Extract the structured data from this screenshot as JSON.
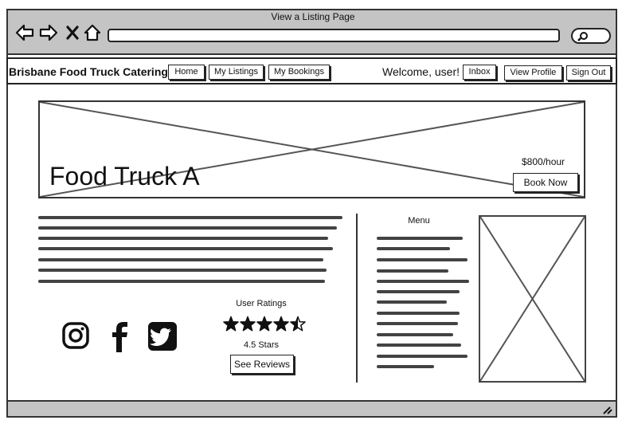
{
  "browser": {
    "title": "View a Listing Page",
    "url": "",
    "search": ""
  },
  "nav": {
    "brand": "Brisbane Food Truck Catering",
    "home": "Home",
    "my_listings": "My Listings",
    "my_bookings": "My Bookings",
    "welcome": "Welcome, user!",
    "inbox": "Inbox",
    "view_profile": "View Profile",
    "sign_out": "Sign Out"
  },
  "hero": {
    "title": "Food Truck A",
    "price": "$800/hour",
    "book_label": "Book Now"
  },
  "menu": {
    "title": "Menu"
  },
  "ratings": {
    "title": "User Ratings",
    "value": 4.5,
    "max": 5,
    "label": "4.5 Stars",
    "reviews_label": "See Reviews"
  },
  "social": [
    "instagram-icon",
    "facebook-icon",
    "twitter-icon"
  ]
}
